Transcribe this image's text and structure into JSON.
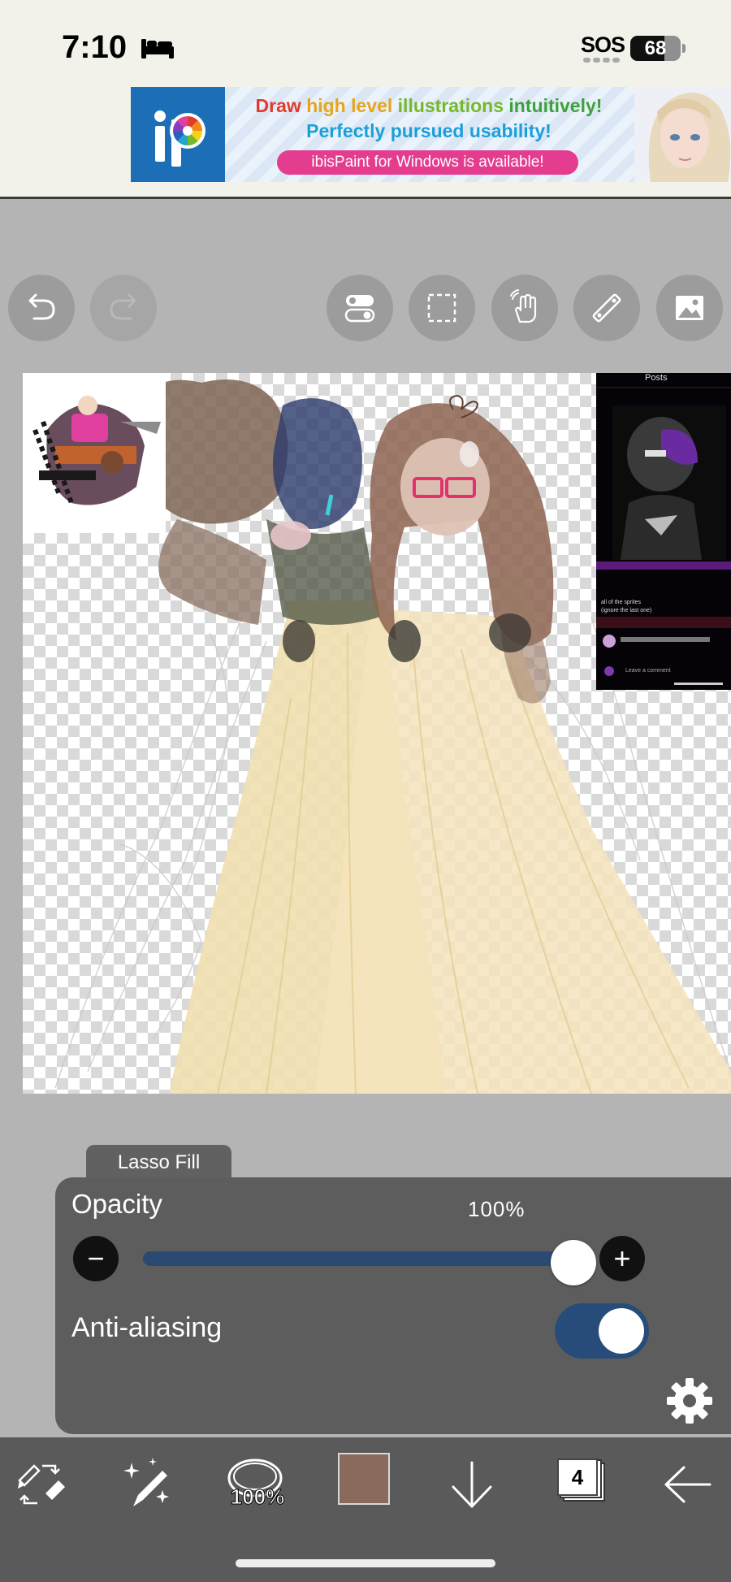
{
  "status_bar": {
    "time": "7:10",
    "sos": "SOS",
    "battery_level": "68",
    "icons": [
      "bed-icon",
      "signal-dots-icon",
      "battery-icon"
    ]
  },
  "ad": {
    "headline_words": [
      "Draw",
      "high level",
      "illustrations",
      "intuitively!"
    ],
    "line2": "Perfectly pursued usability!",
    "pill": "ibisPaint for Windows is available!",
    "colors": {
      "draw": "#e23b2e",
      "high_level": "#e7a51c",
      "illustrations": "#76b82a",
      "intuitively": "#3ea13b",
      "line2": "#1b9fd9",
      "pill": "#e43c8f"
    }
  },
  "toolbar": {
    "buttons": [
      "undo-icon",
      "redo-icon",
      "toggle-icon",
      "selection-icon",
      "hand-icon",
      "ruler-icon",
      "reference-image-icon"
    ]
  },
  "canvas": {
    "reference_screenshot": {
      "header": "Posts",
      "caption1": "all of the sprites",
      "caption2": "(ignore the last one)",
      "comment_placeholder": "Leave a comment"
    }
  },
  "tool_panel": {
    "tab_label": "Lasso Fill",
    "opacity_label": "Opacity",
    "opacity_value": "100%",
    "opacity_fraction": 1.0,
    "anti_aliasing_label": "Anti-aliasing",
    "anti_aliasing_on": true,
    "accent_color": "#2b4a72"
  },
  "bottom_bar": {
    "brush_size": "100%",
    "current_color": "#8b6a5e",
    "layers_count": "4",
    "icons": [
      "swap-tools-icon",
      "magic-brush-icon",
      "brush-size-icon",
      "color-swatch",
      "down-arrow-icon",
      "layers-icon",
      "back-arrow-icon"
    ]
  }
}
